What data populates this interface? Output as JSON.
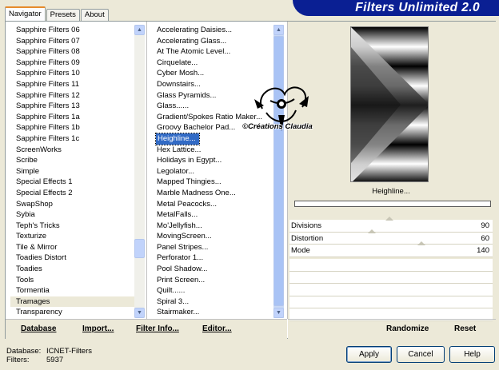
{
  "tabs": [
    "Navigator",
    "Presets",
    "About"
  ],
  "banner_title": "Filters Unlimited 2.0",
  "categories": [
    "Sapphire Filters 06",
    "Sapphire Filters 07",
    "Sapphire Filters 08",
    "Sapphire Filters 09",
    "Sapphire Filters 10",
    "Sapphire Filters 11",
    "Sapphire Filters 12",
    "Sapphire Filters 13",
    "Sapphire Filters 1a",
    "Sapphire Filters 1b",
    "Sapphire Filters 1c",
    "ScreenWorks",
    "Scribe",
    "Simple",
    "Special Effects 1",
    "Special Effects 2",
    "SwapShop",
    "Sybia",
    "Teph's Tricks",
    "Texturize",
    "Tile & Mirror",
    "Toadies Distort",
    "Toadies",
    "Tools",
    "Tormentia",
    "Tramages",
    "Transparency"
  ],
  "selected_category": "Tramages",
  "filters": [
    "Accelerating Daisies...",
    "Accelerating Glass...",
    "At The Atomic Level...",
    "Cirquelate...",
    "Cyber Mosh...",
    "Downstairs...",
    "Glass Pyramids...",
    "Glass......",
    "Gradient/Spokes Ratio Maker...",
    "Groovy Bachelor Pad...",
    "Heighline...",
    "Hex Lattice...",
    "Holidays in Egypt...",
    "Legolator...",
    "Mapped Thingies...",
    "Marble Madness One...",
    "Metal Peacocks...",
    "MetalFalls...",
    "Mo'Jellyfish...",
    "MovingScreen...",
    "Panel Stripes...",
    "Perforator 1...",
    "Pool Shadow...",
    "Print Screen...",
    "Quilt......",
    "Spiral 3...",
    "Stairmaker..."
  ],
  "selected_filter": "Heighline...",
  "nav_buttons": {
    "database": "Database",
    "import": "Import...",
    "filter_info": "Filter Info...",
    "editor": "Editor..."
  },
  "preview_label": "Heighline...",
  "params": [
    {
      "label": "Divisions",
      "value": "90",
      "level": 0.35
    },
    {
      "label": "Distortion",
      "value": "60",
      "level": 0.24
    },
    {
      "label": "Mode",
      "value": "140",
      "level": 0.55
    }
  ],
  "right_buttons": {
    "randomize": "Randomize",
    "reset": "Reset"
  },
  "watermark": "©Créations Claudia",
  "footer": {
    "database_label": "Database:",
    "database_value": "ICNET-Filters",
    "filters_label": "Filters:",
    "filters_value": "5937"
  },
  "dialog_buttons": {
    "apply": "Apply",
    "cancel": "Cancel",
    "help": "Help"
  }
}
